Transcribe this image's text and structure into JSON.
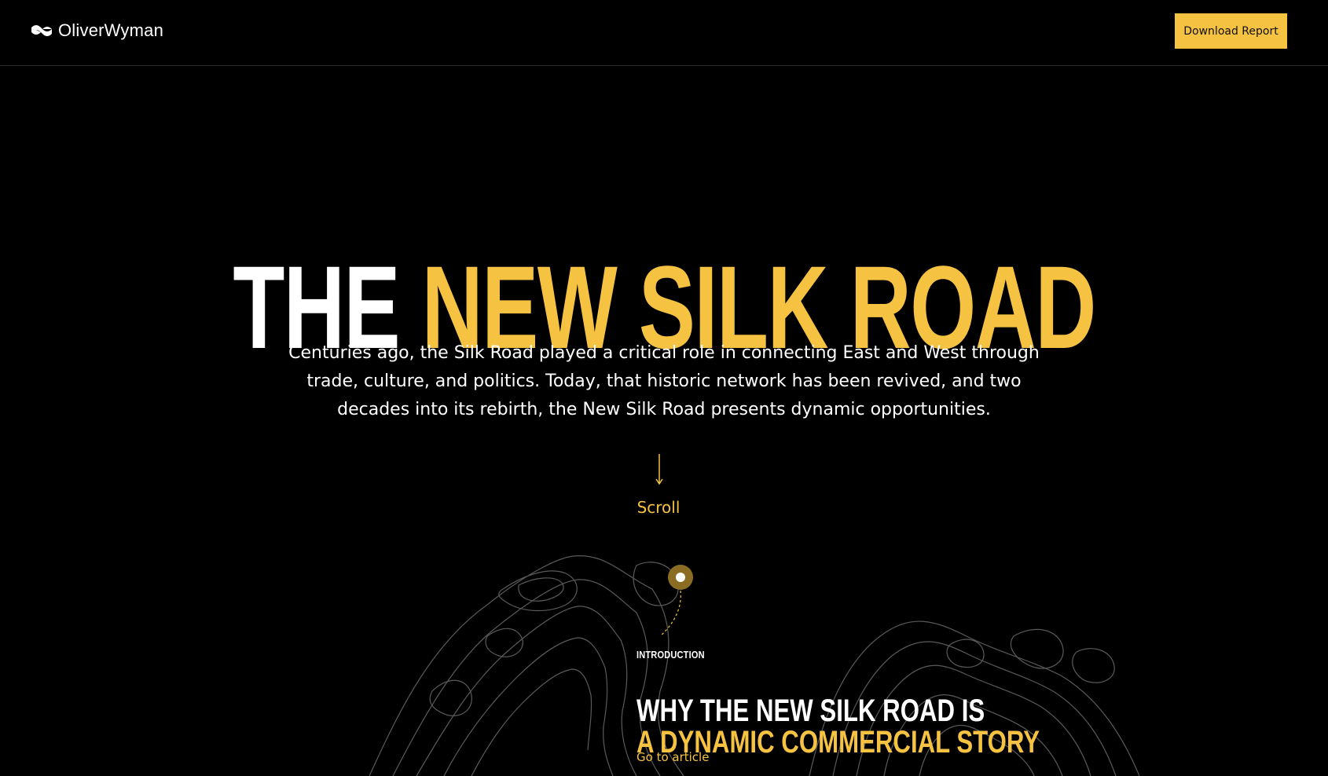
{
  "header": {
    "logo_text": "OliverWyman",
    "download_button": "Download Report"
  },
  "hero": {
    "title_white": "THE",
    "title_yellow": "NEW SILK ROAD",
    "description": "Centuries ago, the Silk Road played a critical role in connecting East and West through trade, culture, and politics. Today, that historic network has been revived, and two decades into its rebirth, the New Silk Road presents dynamic opportunities.",
    "scroll_label": "Scroll"
  },
  "intro": {
    "label": "INTRODUCTION",
    "title_line1": "WHY THE NEW SILK ROAD IS",
    "title_line2": "A DYNAMIC COMMERCIAL STORY",
    "link_text": "Go to article"
  },
  "colors": {
    "accent": "#f5c242",
    "background": "#000000",
    "text": "#ffffff"
  },
  "icons": {
    "logo": "oliver-wyman-logo-icon",
    "scroll": "arrow-down-icon",
    "marker": "location-marker-icon"
  }
}
